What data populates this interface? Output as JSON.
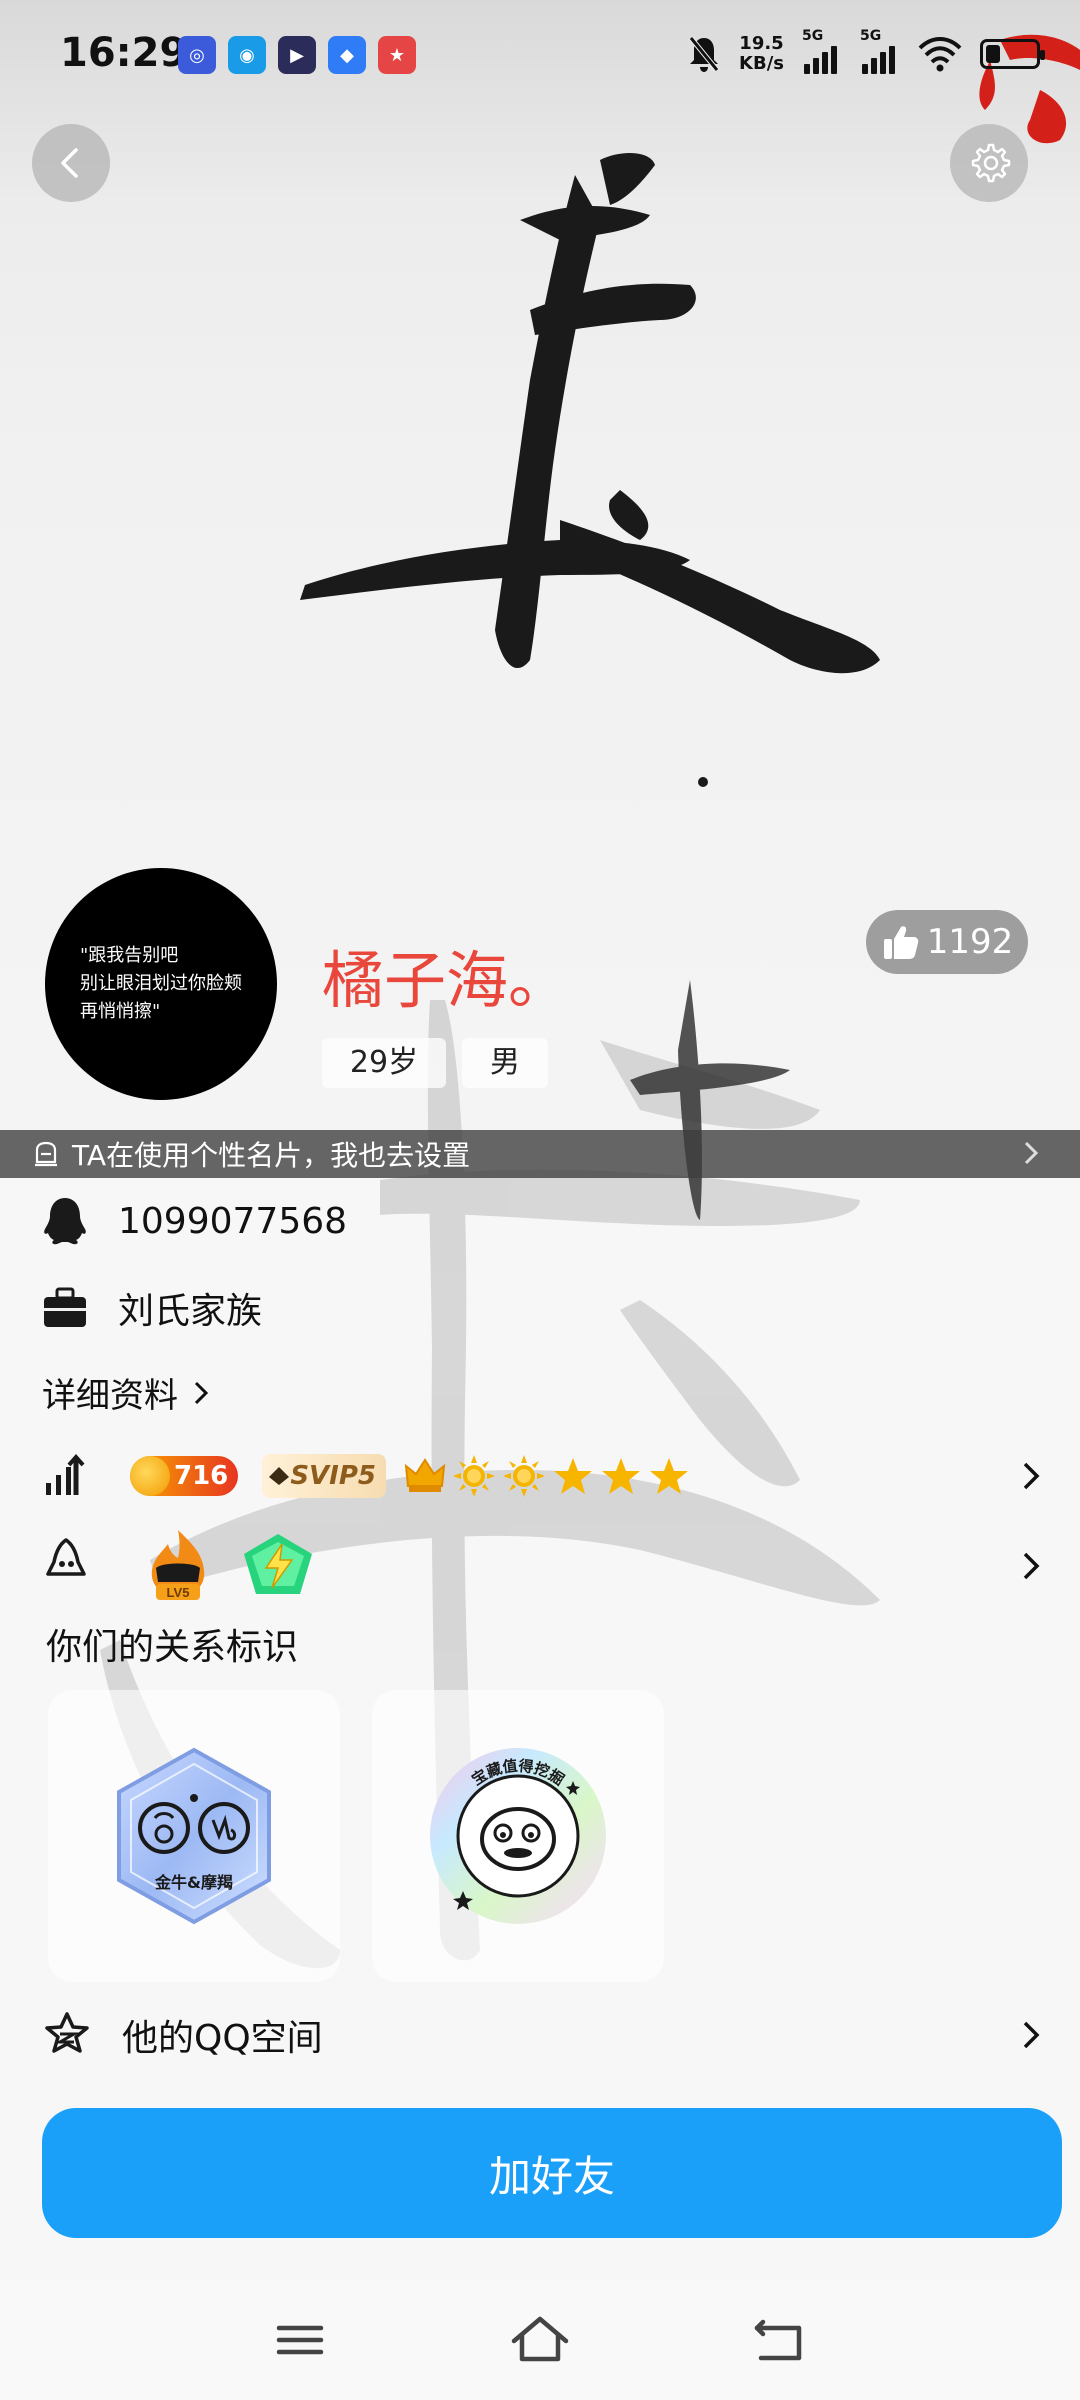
{
  "status_bar": {
    "time": "16:29",
    "speed_value": "19.5",
    "speed_unit": "KB/s",
    "signal_label_1": "5G",
    "signal_label_2": "5G",
    "app_icons": [
      "app-icon-1",
      "app-icon-2",
      "app-icon-3",
      "app-icon-4",
      "app-icon-5"
    ]
  },
  "profile": {
    "avatar_text": "\"跟我告别吧\n别让眼泪划过你脸颊\n再悄悄擦\"",
    "nickname": "橘子海。",
    "age": "29岁",
    "gender": "男",
    "likes": "1192"
  },
  "banner": {
    "text": "TA在使用个性名片，我也去设置"
  },
  "info": {
    "qq_number": "1099077568",
    "group": "刘氏家族",
    "detail_link": "详细资料"
  },
  "badges": {
    "coin_level": "716",
    "svip": "SVIP5",
    "game_level": "LV5"
  },
  "relationship": {
    "title": "你们的关系标识",
    "card1_label": "金牛&摩羯",
    "card2_label": "宝藏值得挖掘"
  },
  "qzone": {
    "label": "他的QQ空间"
  },
  "actions": {
    "add_friend": "加好友"
  },
  "colors": {
    "nickname": "#e9473b",
    "primary_button": "#1ba0fa"
  }
}
